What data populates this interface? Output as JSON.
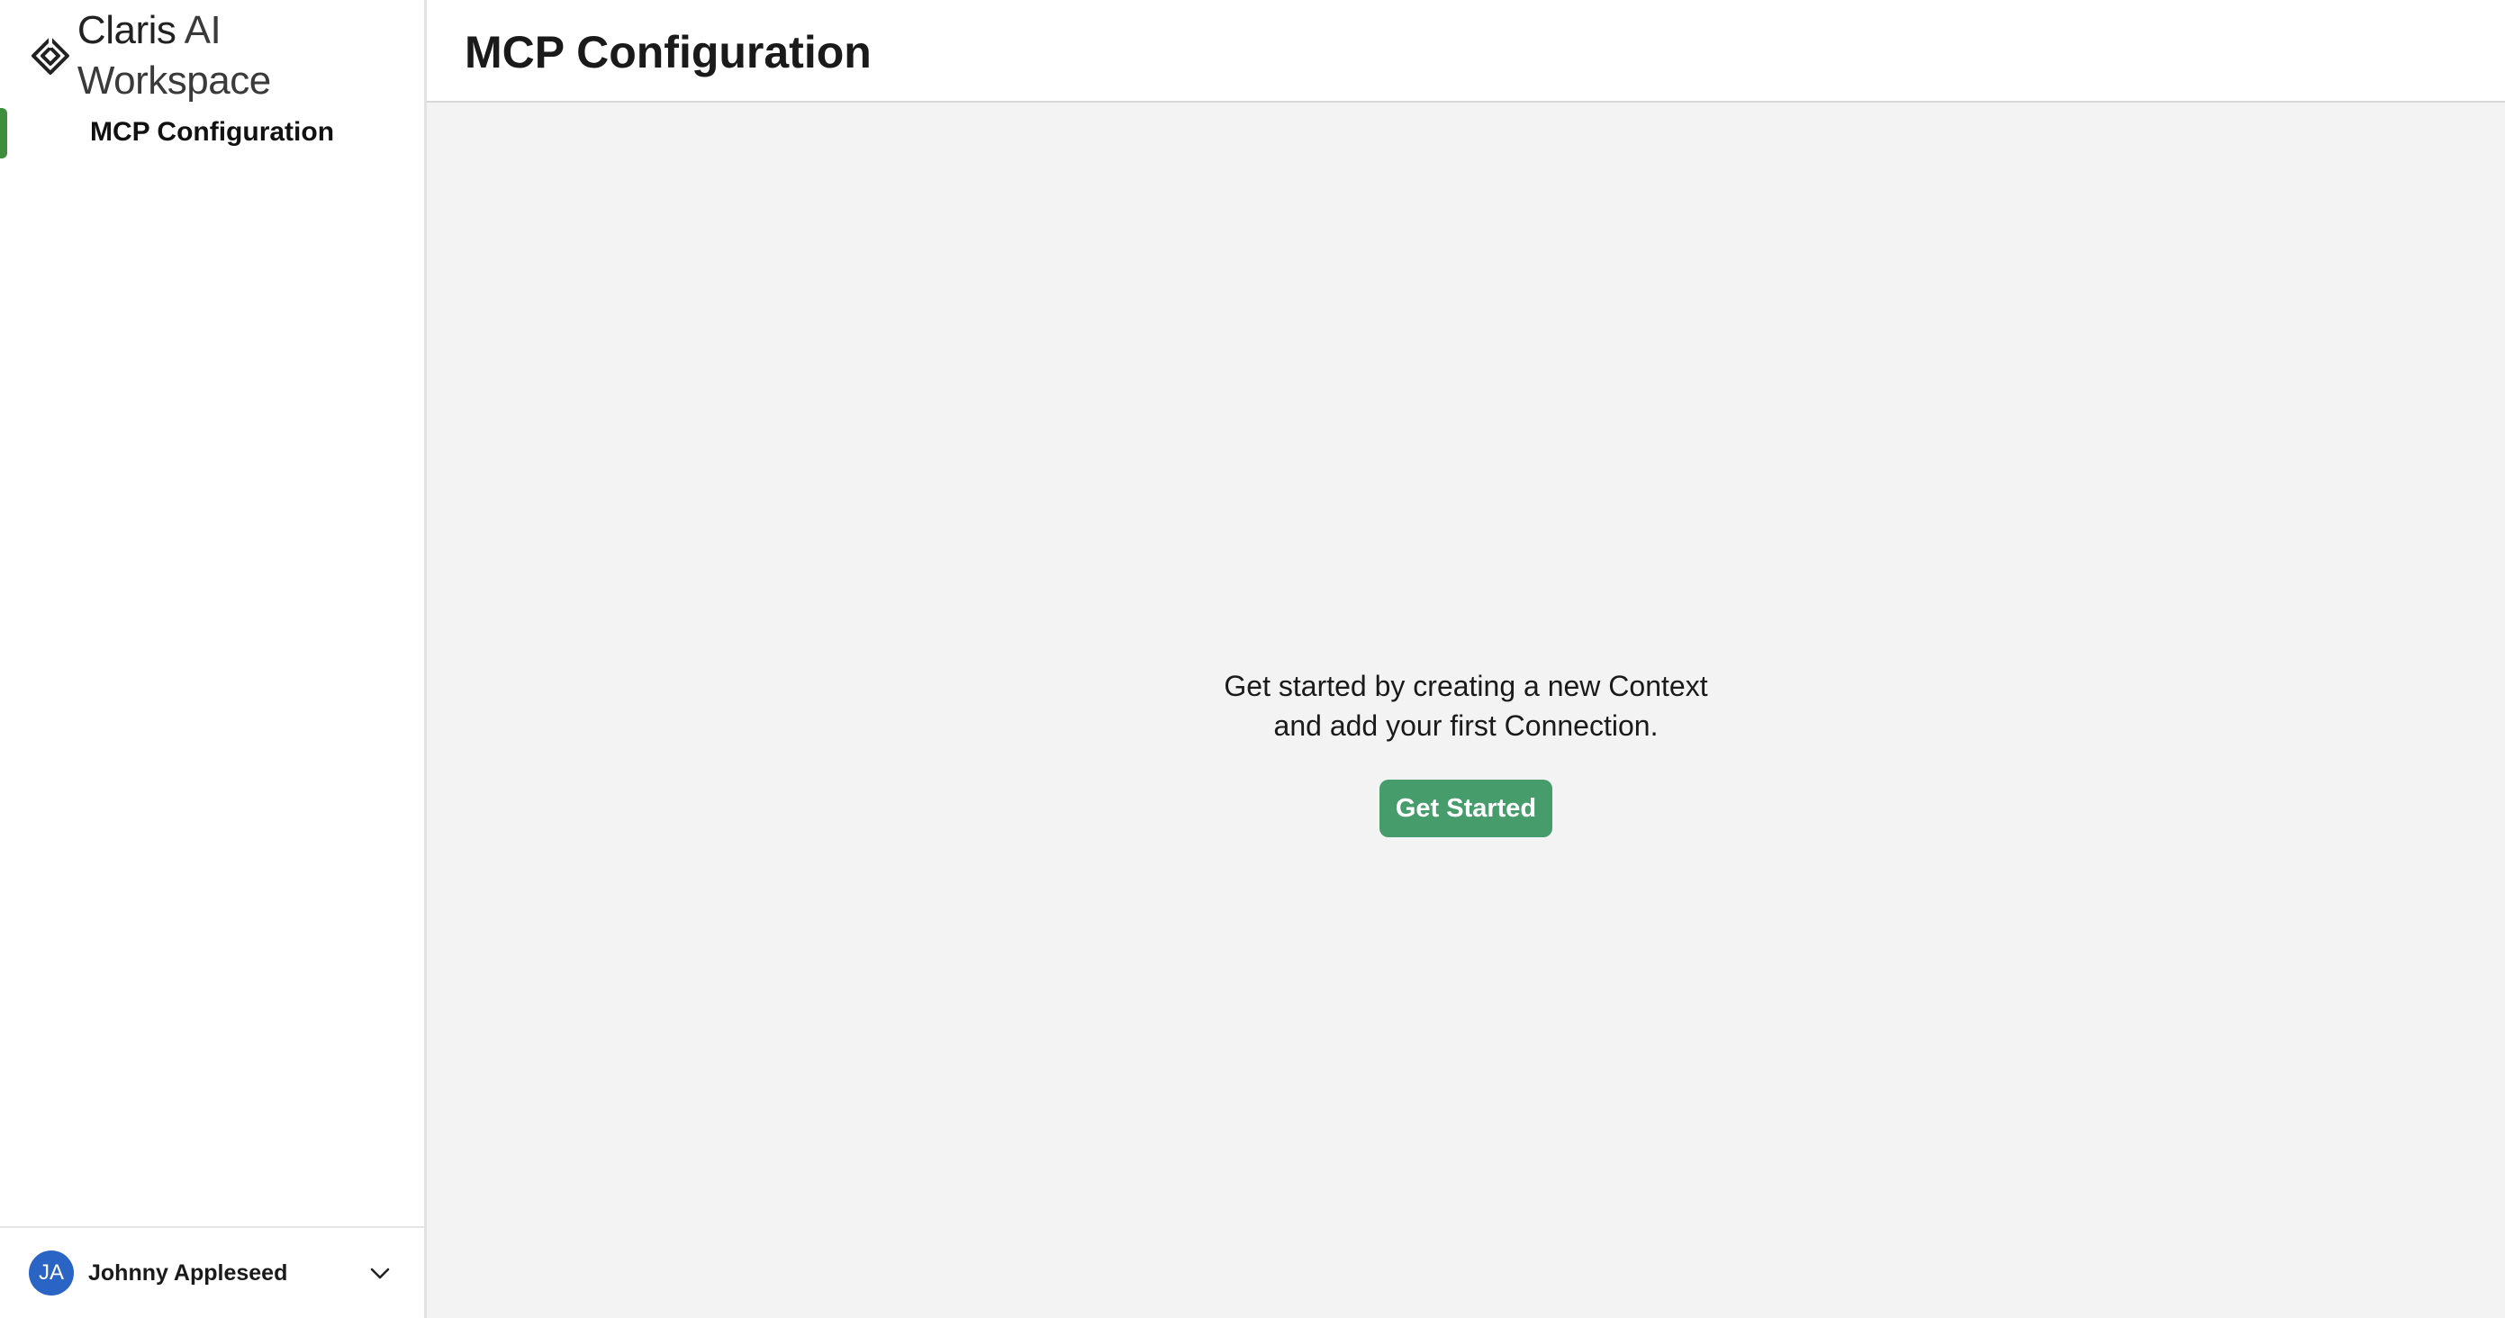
{
  "app": {
    "brand_primary": "Claris",
    "brand_secondary": " AI Workspace",
    "accent_color": "#3e8e3e",
    "button_color": "#479c6c"
  },
  "sidebar": {
    "items": [
      {
        "label": "MCP Configuration",
        "active": true
      }
    ]
  },
  "user": {
    "initials": "JA",
    "name": "Johnny Appleseed",
    "avatar_color": "#2a64c5",
    "menu_icon": "chevron-down-icon"
  },
  "header": {
    "title": "MCP Configuration"
  },
  "main": {
    "empty_state": {
      "line1": "Get started by creating a new Context",
      "line2": "and add your first Connection.",
      "button_label": "Get Started"
    }
  }
}
